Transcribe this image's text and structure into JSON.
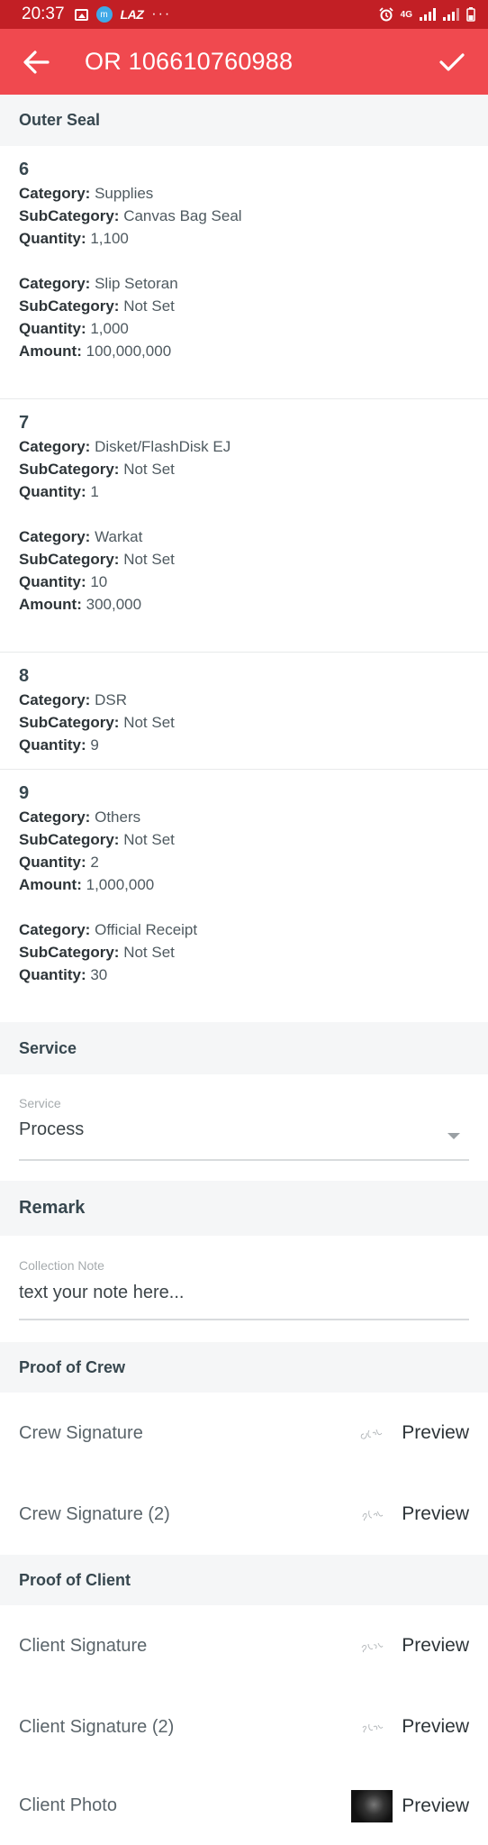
{
  "status_bar": {
    "time": "20:37",
    "app_badge": "LAZ",
    "more": "···",
    "network": "4G"
  },
  "app_bar": {
    "title": "OR 106610760988",
    "back_icon": "arrow-left-icon",
    "confirm_icon": "check-icon"
  },
  "outer_seal": {
    "header": "Outer Seal",
    "seals": [
      {
        "number": "6",
        "items": [
          {
            "category": "Supplies",
            "subcategory": "Canvas Bag Seal",
            "quantity": "1,100"
          },
          {
            "category": "Slip Setoran",
            "subcategory": "Not Set",
            "quantity": "1,000",
            "amount": "100,000,000"
          }
        ]
      },
      {
        "number": "7",
        "items": [
          {
            "category": "Disket/FlashDisk EJ",
            "subcategory": "Not Set",
            "quantity": "1"
          },
          {
            "category": "Warkat",
            "subcategory": "Not Set",
            "quantity": "10",
            "amount": "300,000"
          }
        ]
      },
      {
        "number": "8",
        "items": [
          {
            "category": "DSR",
            "subcategory": "Not Set",
            "quantity": "9"
          }
        ]
      },
      {
        "number": "9",
        "items": [
          {
            "category": "Others",
            "subcategory": "Not Set",
            "quantity": "2",
            "amount": "1,000,000"
          },
          {
            "category": "Official Receipt",
            "subcategory": "Not Set",
            "quantity": "30"
          }
        ]
      }
    ],
    "labels": {
      "category": "Category:",
      "subcategory": "SubCategory:",
      "quantity": "Quantity:",
      "amount": "Amount:"
    }
  },
  "service": {
    "header": "Service",
    "field_label": "Service",
    "value": "Process"
  },
  "remark": {
    "header": "Remark",
    "field_label": "Collection Note",
    "placeholder": "text your note here..."
  },
  "proof_of_crew": {
    "header": "Proof of Crew",
    "rows": [
      {
        "label": "Crew Signature",
        "preview": "Preview"
      },
      {
        "label": "Crew Signature (2)",
        "preview": "Preview"
      }
    ]
  },
  "proof_of_client": {
    "header": "Proof of Client",
    "rows": [
      {
        "label": "Client Signature",
        "preview": "Preview"
      },
      {
        "label": "Client Signature (2)",
        "preview": "Preview"
      },
      {
        "label": "Client Photo",
        "preview": "Preview"
      }
    ]
  },
  "colors": {
    "status_bar": "#c21f25",
    "app_bar": "#f0494f",
    "section_bg": "#f5f6f7"
  }
}
